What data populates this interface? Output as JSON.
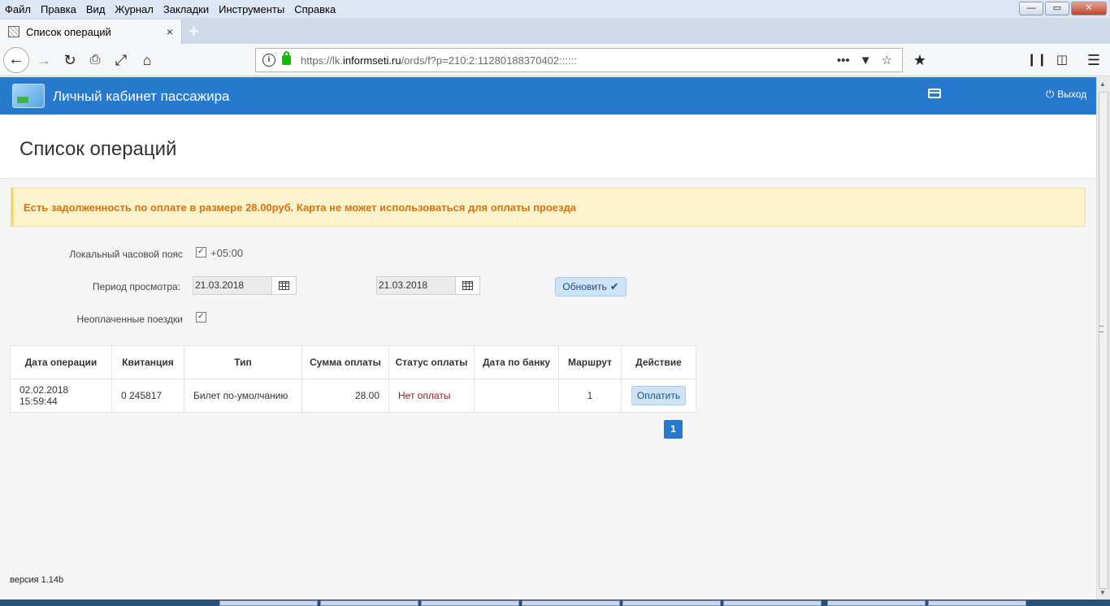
{
  "browser": {
    "menu": [
      {
        "label": "Файл"
      },
      {
        "label": "Правка"
      },
      {
        "label": "Вид"
      },
      {
        "label": "Журнал"
      },
      {
        "label": "Закладки"
      },
      {
        "label": "Инструменты"
      },
      {
        "label": "Справка"
      }
    ],
    "tab": {
      "title": "Список операций",
      "close": "×"
    },
    "new_tab": "+",
    "url_prefix": "https://lk.",
    "url_host": "informseti.ru",
    "url_path": "/ords/f?p=210:2:11280188370402::::::",
    "url_menu": "•••",
    "window_controls": {
      "minimize": "—",
      "restore": "▭",
      "close": "✕"
    }
  },
  "app": {
    "title": "Личный кабинет пассажира",
    "logout": "Выход",
    "page_title": "Список операций",
    "alert": "Есть задолженность по оплате в размере 28.00руб. Карта не может использоваться для оплаты проезда",
    "colors": {
      "header": "#2679cf",
      "alert_bg": "#fcf3cd",
      "alert_text": "#d9730d",
      "unpaid": "#a31515"
    }
  },
  "filters": {
    "timezone_label": "Локальный часовой пояс",
    "timezone_checked": true,
    "timezone_value": "+05:00",
    "period_label": "Период просмотра:",
    "date_from": "21.03.2018",
    "date_to": "21.03.2018",
    "refresh_label": "Обновить",
    "unpaid_label": "Неоплаченные поездки",
    "unpaid_checked": true
  },
  "table": {
    "columns": [
      "Дата операции",
      "Квитанция",
      "Тип",
      "Сумма оплаты",
      "Статус оплаты",
      "Дата по банку",
      "Маршрут",
      "Действие"
    ],
    "rows": [
      {
        "date": "02.02.2018 15:59:44",
        "receipt": "0 245817",
        "type": "Билет по-умолчанию",
        "amount": "28.00",
        "status": "Нет оплаты",
        "bank_date": "",
        "route": "1",
        "action": "Оплатить"
      }
    ]
  },
  "pagination": {
    "current": "1"
  },
  "footer": {
    "version": "версия 1.14b"
  }
}
